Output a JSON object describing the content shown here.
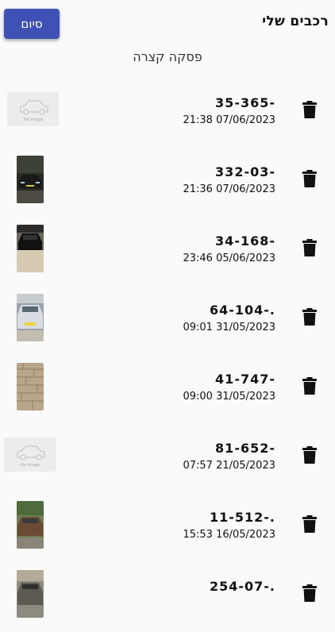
{
  "header": {
    "title": "רכבים שלי",
    "done_label": "סיום"
  },
  "subtitle": "פסקה קצרה",
  "vehicles": [
    {
      "plate": "35-365-",
      "date": "21:38 07/06/2023",
      "image": "no-image"
    },
    {
      "plate": "332-03-",
      "date": "21:36 07/06/2023",
      "image": "photo-car-night"
    },
    {
      "plate": "34-168-",
      "date": "23:46 05/06/2023",
      "image": "photo-car-garage"
    },
    {
      "plate": "64-104-.",
      "date": "09:01 31/05/2023",
      "image": "photo-silver-car"
    },
    {
      "plate": "41-747-",
      "date": "09:00 31/05/2023",
      "image": "photo-stone-wall"
    },
    {
      "plate": "81-652-",
      "date": "07:57 21/05/2023",
      "image": "no-image"
    },
    {
      "plate": "11-512-.",
      "date": "15:53 16/05/2023",
      "image": "photo-car-trees"
    },
    {
      "plate": "254-07-.",
      "date": "",
      "image": "photo-car-street"
    }
  ],
  "no_image_text": "No Image",
  "colors": {
    "accent": "#3f51b5",
    "background": "#fafafa"
  }
}
